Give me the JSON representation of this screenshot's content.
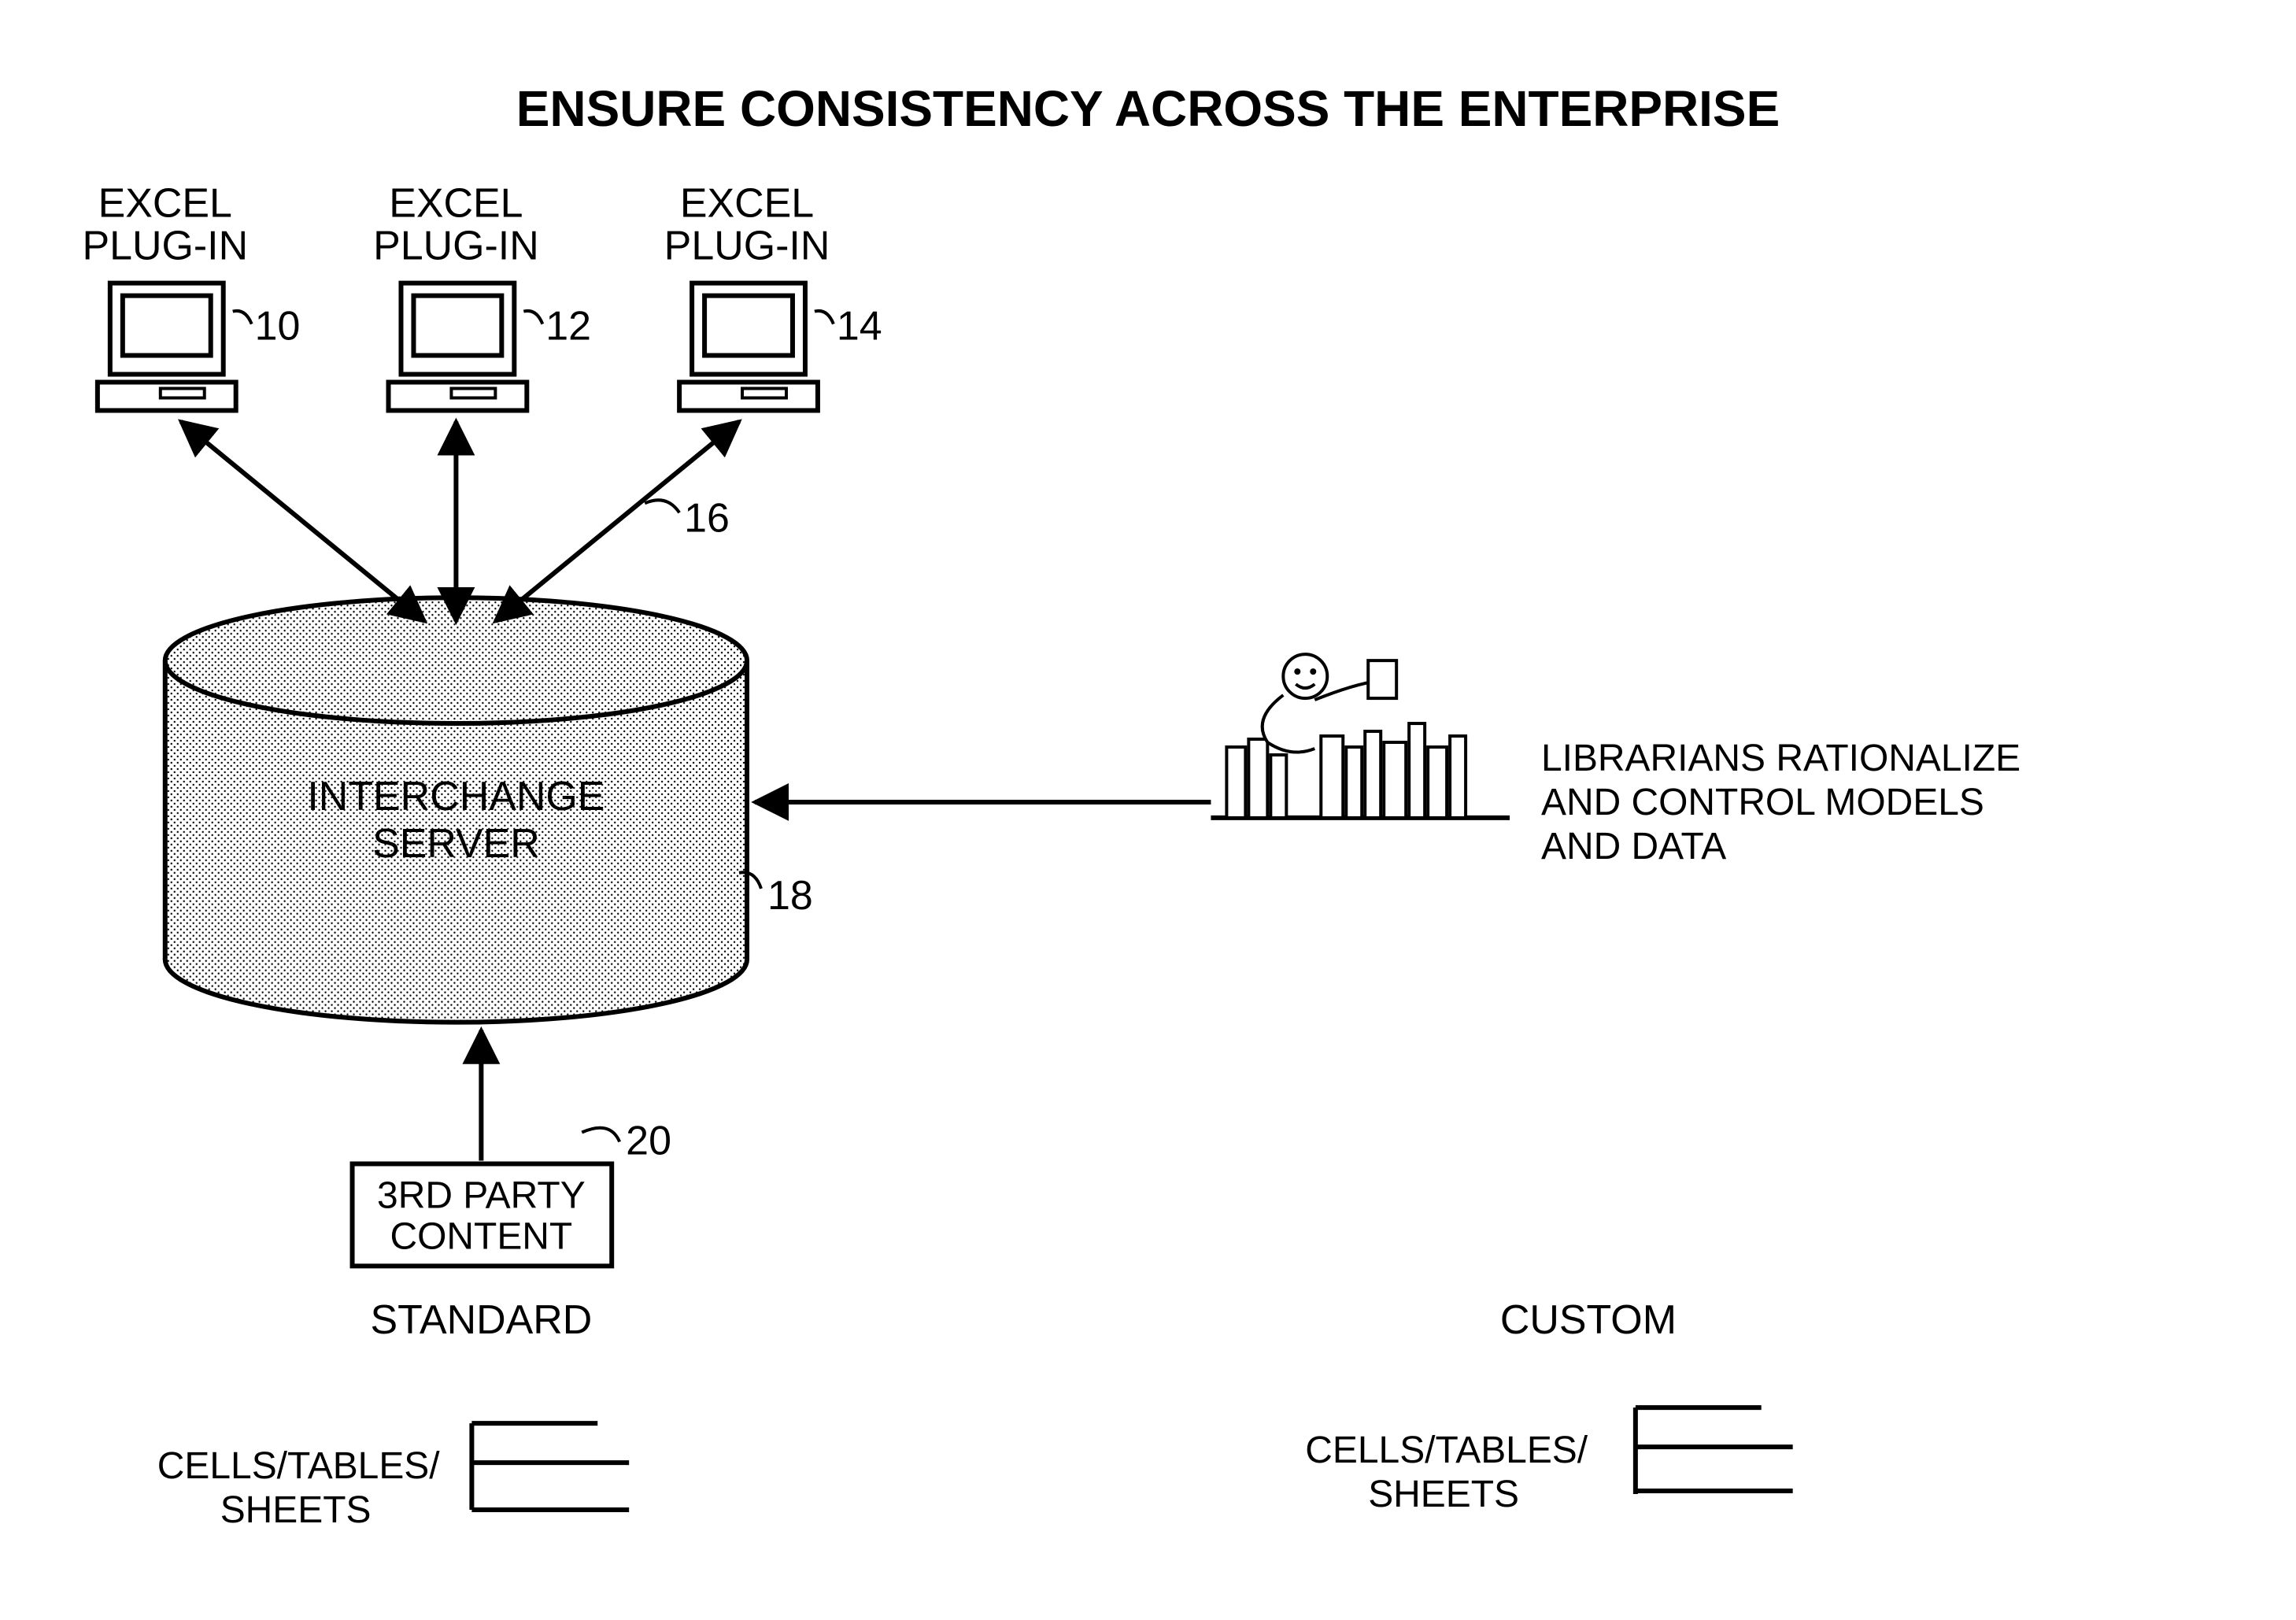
{
  "title": "ENSURE CONSISTENCY ACROSS THE ENTERPRISE",
  "clients": [
    {
      "label1": "EXCEL",
      "label2": "PLUG-IN",
      "ref": "10"
    },
    {
      "label1": "EXCEL",
      "label2": "PLUG-IN",
      "ref": "12"
    },
    {
      "label1": "EXCEL",
      "label2": "PLUG-IN",
      "ref": "14"
    }
  ],
  "link_ref": "16",
  "server": {
    "line1": "INTERCHANGE",
    "line2": "SERVER",
    "ref": "18"
  },
  "third_party": {
    "line1": "3RD PARTY",
    "line2": "CONTENT",
    "ref": "20"
  },
  "librarian": {
    "line1": "LIBRARIANS RATIONALIZE",
    "line2": "AND CONTROL MODELS",
    "line3": "AND DATA"
  },
  "standard": {
    "heading": "STANDARD",
    "line1": "CELLS/TABLES/",
    "line2": "SHEETS"
  },
  "custom": {
    "heading": "CUSTOM",
    "line1": "CELLS/TABLES/",
    "line2": "SHEETS"
  }
}
